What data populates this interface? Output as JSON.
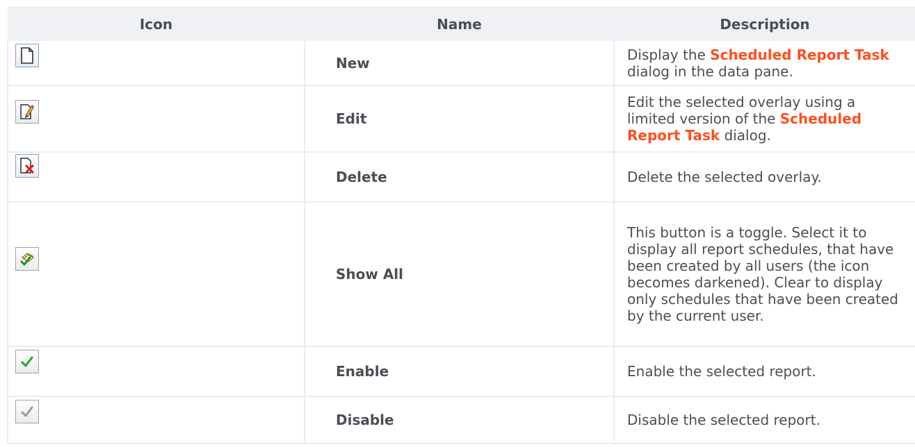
{
  "headers": {
    "icon": "Icon",
    "name": "Name",
    "description": "Description"
  },
  "rows": [
    {
      "icon": "new-document-icon",
      "name": "New",
      "desc_parts": [
        "Display the ",
        "Scheduled Report Task",
        " dialog in the data pane."
      ]
    },
    {
      "icon": "edit-pencil-icon",
      "name": "Edit",
      "desc_parts": [
        "Edit the selected overlay using a limited version of the ",
        "Scheduled Report Task",
        " dialog."
      ]
    },
    {
      "icon": "delete-document-icon",
      "name": "Delete",
      "desc": "Delete the selected overlay."
    },
    {
      "icon": "show-all-icon",
      "name": "Show All",
      "desc": "This button is a toggle. Select it to display all report schedules, that have been created by all users (the icon becomes darkened). Clear to display only schedules that have been created by the current user."
    },
    {
      "icon": "enable-checkmark-icon",
      "name": "Enable",
      "desc": "Enable the selected report."
    },
    {
      "icon": "disable-checkmark-icon",
      "name": "Disable",
      "desc": "Disable the selected report."
    }
  ],
  "colors": {
    "accent_link": "#ff4f1f",
    "header_bg": "#eff1f5",
    "text": "#4a4f56",
    "enable_check": "#2aa52a",
    "disable_check": "#9a9a9a"
  }
}
